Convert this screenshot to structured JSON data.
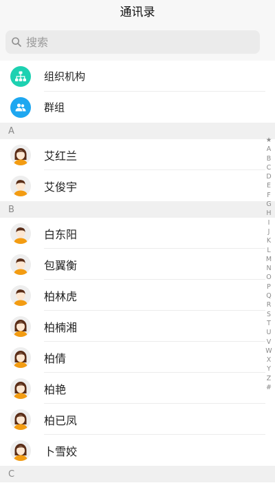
{
  "header": {
    "title": "通讯录"
  },
  "search": {
    "placeholder": "搜索",
    "value": ""
  },
  "functions": [
    {
      "label": "组织机构",
      "icon": "org-chart-icon",
      "color": "#1dd1b1"
    },
    {
      "label": "群组",
      "icon": "group-icon",
      "color": "#1ea7f0"
    }
  ],
  "sections": [
    {
      "letter": "A",
      "contacts": [
        {
          "name": "艾红兰",
          "avatar": "female-avatar-icon"
        },
        {
          "name": "艾俊宇",
          "avatar": "male-avatar-icon"
        }
      ]
    },
    {
      "letter": "B",
      "contacts": [
        {
          "name": "白东阳",
          "avatar": "male-avatar-icon"
        },
        {
          "name": "包翼衡",
          "avatar": "male-avatar-icon"
        },
        {
          "name": "柏林虎",
          "avatar": "male-avatar-icon"
        },
        {
          "name": "柏楠湘",
          "avatar": "female-avatar-icon"
        },
        {
          "name": "柏倩",
          "avatar": "female-avatar-icon"
        },
        {
          "name": "柏艳",
          "avatar": "female-avatar-icon"
        },
        {
          "name": "柏已凤",
          "avatar": "female-avatar-icon"
        },
        {
          "name": "卜雪姣",
          "avatar": "female-avatar-icon"
        }
      ]
    },
    {
      "letter": "C",
      "contacts": []
    }
  ],
  "index_bar": [
    "★",
    "A",
    "B",
    "C",
    "D",
    "E",
    "F",
    "G",
    "H",
    "I",
    "J",
    "K",
    "L",
    "M",
    "N",
    "O",
    "P",
    "Q",
    "R",
    "S",
    "T",
    "U",
    "V",
    "W",
    "X",
    "Y",
    "Z",
    "#"
  ],
  "colors": {
    "avatar_bg": "#eeeeee",
    "skin": "#fde7d2",
    "hair": "#5a2d17",
    "clothes": "#f39c12"
  }
}
